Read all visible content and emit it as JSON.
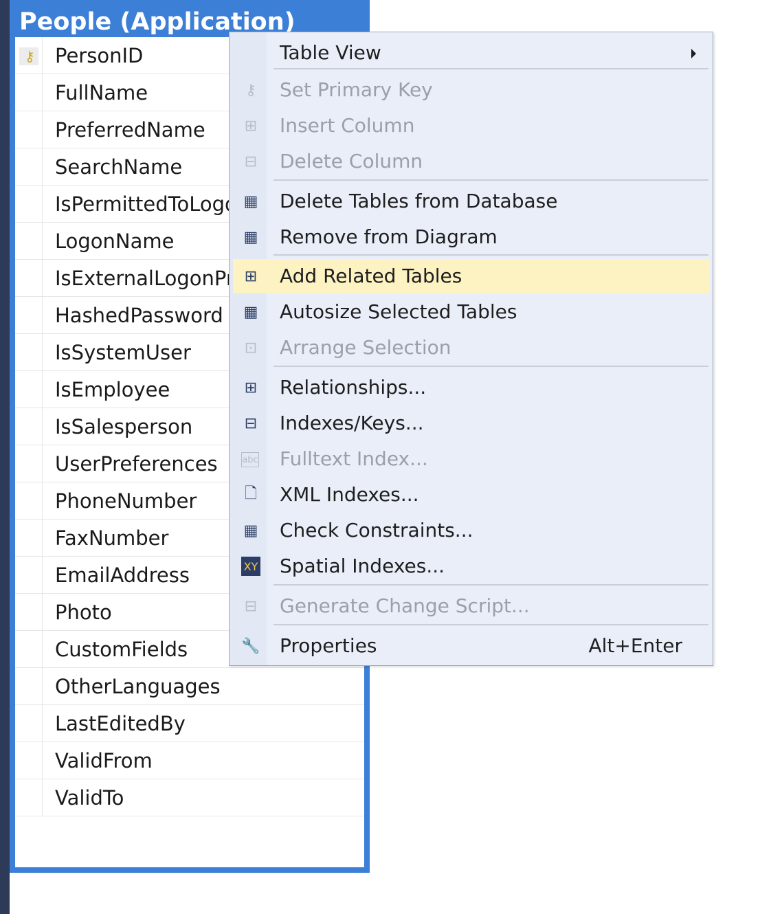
{
  "table": {
    "title": "People (Application)",
    "columns": [
      {
        "name": "PersonID",
        "is_primary_key": true
      },
      {
        "name": "FullName"
      },
      {
        "name": "PreferredName"
      },
      {
        "name": "SearchName"
      },
      {
        "name": "IsPermittedToLogon"
      },
      {
        "name": "LogonName"
      },
      {
        "name": "IsExternalLogonProvider"
      },
      {
        "name": "HashedPassword"
      },
      {
        "name": "IsSystemUser"
      },
      {
        "name": "IsEmployee"
      },
      {
        "name": "IsSalesperson"
      },
      {
        "name": "UserPreferences"
      },
      {
        "name": "PhoneNumber"
      },
      {
        "name": "FaxNumber"
      },
      {
        "name": "EmailAddress"
      },
      {
        "name": "Photo"
      },
      {
        "name": "CustomFields"
      },
      {
        "name": "OtherLanguages"
      },
      {
        "name": "LastEditedBy"
      },
      {
        "name": "ValidFrom"
      },
      {
        "name": "ValidTo"
      }
    ]
  },
  "context_menu": {
    "items": {
      "table_view": {
        "label": "Table View",
        "has_submenu": true
      },
      "set_primary_key": {
        "label": "Set Primary Key",
        "enabled": false,
        "icon": "key-icon"
      },
      "insert_column": {
        "label": "Insert Column",
        "enabled": false,
        "icon": "insert-column-icon"
      },
      "delete_column": {
        "label": "Delete Column",
        "enabled": false,
        "icon": "delete-column-icon"
      },
      "delete_tables": {
        "label": "Delete Tables from Database",
        "enabled": true,
        "icon": "delete-table-icon"
      },
      "remove_from_diagram": {
        "label": "Remove from Diagram",
        "enabled": true,
        "icon": "remove-table-icon"
      },
      "add_related_tables": {
        "label": "Add Related Tables",
        "enabled": true,
        "highlighted": true,
        "icon": "add-related-tables-icon"
      },
      "autosize_tables": {
        "label": "Autosize Selected Tables",
        "enabled": true,
        "icon": "autosize-icon"
      },
      "arrange_selection": {
        "label": "Arrange Selection",
        "enabled": false,
        "icon": "arrange-icon"
      },
      "relationships": {
        "label": "Relationships...",
        "enabled": true,
        "icon": "relationships-icon"
      },
      "indexes_keys": {
        "label": "Indexes/Keys...",
        "enabled": true,
        "icon": "indexes-icon"
      },
      "fulltext_index": {
        "label": "Fulltext Index...",
        "enabled": false,
        "icon": "fulltext-icon"
      },
      "xml_indexes": {
        "label": "XML Indexes...",
        "enabled": true,
        "icon": "xml-index-icon"
      },
      "check_constraints": {
        "label": "Check Constraints...",
        "enabled": true,
        "icon": "check-constraints-icon"
      },
      "spatial_indexes": {
        "label": "Spatial Indexes...",
        "enabled": true,
        "icon": "spatial-index-icon"
      },
      "generate_change_script": {
        "label": "Generate Change Script...",
        "enabled": false,
        "icon": "script-icon"
      },
      "properties": {
        "label": "Properties",
        "shortcut": "Alt+Enter",
        "enabled": true,
        "icon": "wrench-icon"
      }
    }
  },
  "colors": {
    "title_bar": "#3c7fd6",
    "menu_background": "#e9eef9",
    "menu_highlight": "#fcf2c2",
    "disabled_text": "#9aa0a9"
  }
}
